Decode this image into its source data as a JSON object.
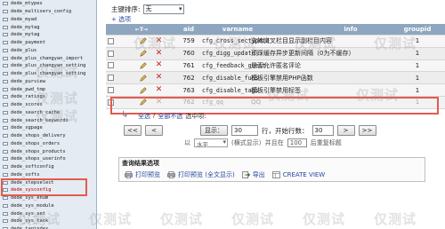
{
  "sidebar": {
    "items": [
      {
        "label": "dede_mtypes"
      },
      {
        "label": "dede_multiserv_config"
      },
      {
        "label": "dede_myad"
      },
      {
        "label": "dede_mytag"
      },
      {
        "label": "dede_mytag"
      },
      {
        "label": "dede_payment"
      },
      {
        "label": "dede_plus"
      },
      {
        "label": "dede_plus_changyan_import"
      },
      {
        "label": "dede_plus_changyan_setting"
      },
      {
        "label": "dede_plus_changyan_setting"
      },
      {
        "label": "dede_purview"
      },
      {
        "label": "dede_pwd_tmp"
      },
      {
        "label": "dede_ratings"
      },
      {
        "label": "dede_scores"
      },
      {
        "label": "dede_search_cache"
      },
      {
        "label": "dede_search_keywords"
      },
      {
        "label": "dede_sgpage"
      },
      {
        "label": "dede_shops_delivery"
      },
      {
        "label": "dede_shops_orders"
      },
      {
        "label": "dede_shops_products"
      },
      {
        "label": "dede_shops_userinfo"
      },
      {
        "label": "dede_softconfig"
      },
      {
        "label": "dede_softs"
      },
      {
        "label": "dede_stepselect"
      },
      {
        "label": "dede_sysconfig"
      },
      {
        "label": "dede_sys_enum"
      },
      {
        "label": "dede_sys_module"
      },
      {
        "label": "dede_sys_set"
      },
      {
        "label": "dede_sys_task"
      },
      {
        "label": "dede_tagindex"
      }
    ],
    "active_index": 24
  },
  "sort": {
    "label": "主键排序:",
    "value": "无"
  },
  "options_link": "+ 选项",
  "grid": {
    "headers": {
      "arrows": "←T→",
      "aid": "aid",
      "varname": "varname",
      "info": "info",
      "groupid": "groupid"
    },
    "rows": [
      {
        "aid": "759",
        "varname": "cfg_cross_sectypeid",
        "info": "支持交叉栏目显示副栏目内容",
        "groupid": "1"
      },
      {
        "aid": "760",
        "varname": "cfg_digg_update",
        "info": "顶踩缓存异步更新间隔（0为不缓存）",
        "groupid": "1"
      },
      {
        "aid": "761",
        "varname": "cfg_feedback_guest",
        "info": "是否允许匿名评论",
        "groupid": "1"
      },
      {
        "aid": "762",
        "varname": "cfg_disable_funs",
        "info": "模板引擎禁用PHP函数",
        "groupid": "1"
      },
      {
        "aid": "763",
        "varname": "cfg_disable_tags",
        "info": "模板引擎禁用标签",
        "groupid": "1"
      },
      {
        "aid": "762",
        "varname": "cfg_qq",
        "info": "QQ",
        "groupid": "1"
      }
    ]
  },
  "selection": {
    "all": "全选",
    "sep": "/",
    "none": "全部不选",
    "with_selected": "选中项:"
  },
  "navigation": {
    "prev": "<<",
    "first": "<",
    "show_button": "显示：",
    "rows_value": "30",
    "rows_label": "行，开始行数：",
    "start_value": "30",
    "next": ">",
    "last": ">>"
  },
  "mode": {
    "prefix": "以",
    "mode_value": "水平",
    "mid": "(横式显示）并且在",
    "repeat_value": "100",
    "suffix": "后重复标题"
  },
  "query_results": {
    "title": "查询结果选项",
    "actions": [
      {
        "label": "打印预览",
        "icon": "printer-icon"
      },
      {
        "label": "打印预览 (全文显示)",
        "icon": "printer-icon"
      },
      {
        "label": "导出",
        "icon": "export-icon"
      },
      {
        "label": "CREATE VIEW",
        "icon": "view-icon"
      }
    ]
  },
  "watermark": "仅测试",
  "colors": {
    "header": "#8ea6bf",
    "highlight": "#e45a4f",
    "delete": "#c82020",
    "link": "#2346a0"
  }
}
